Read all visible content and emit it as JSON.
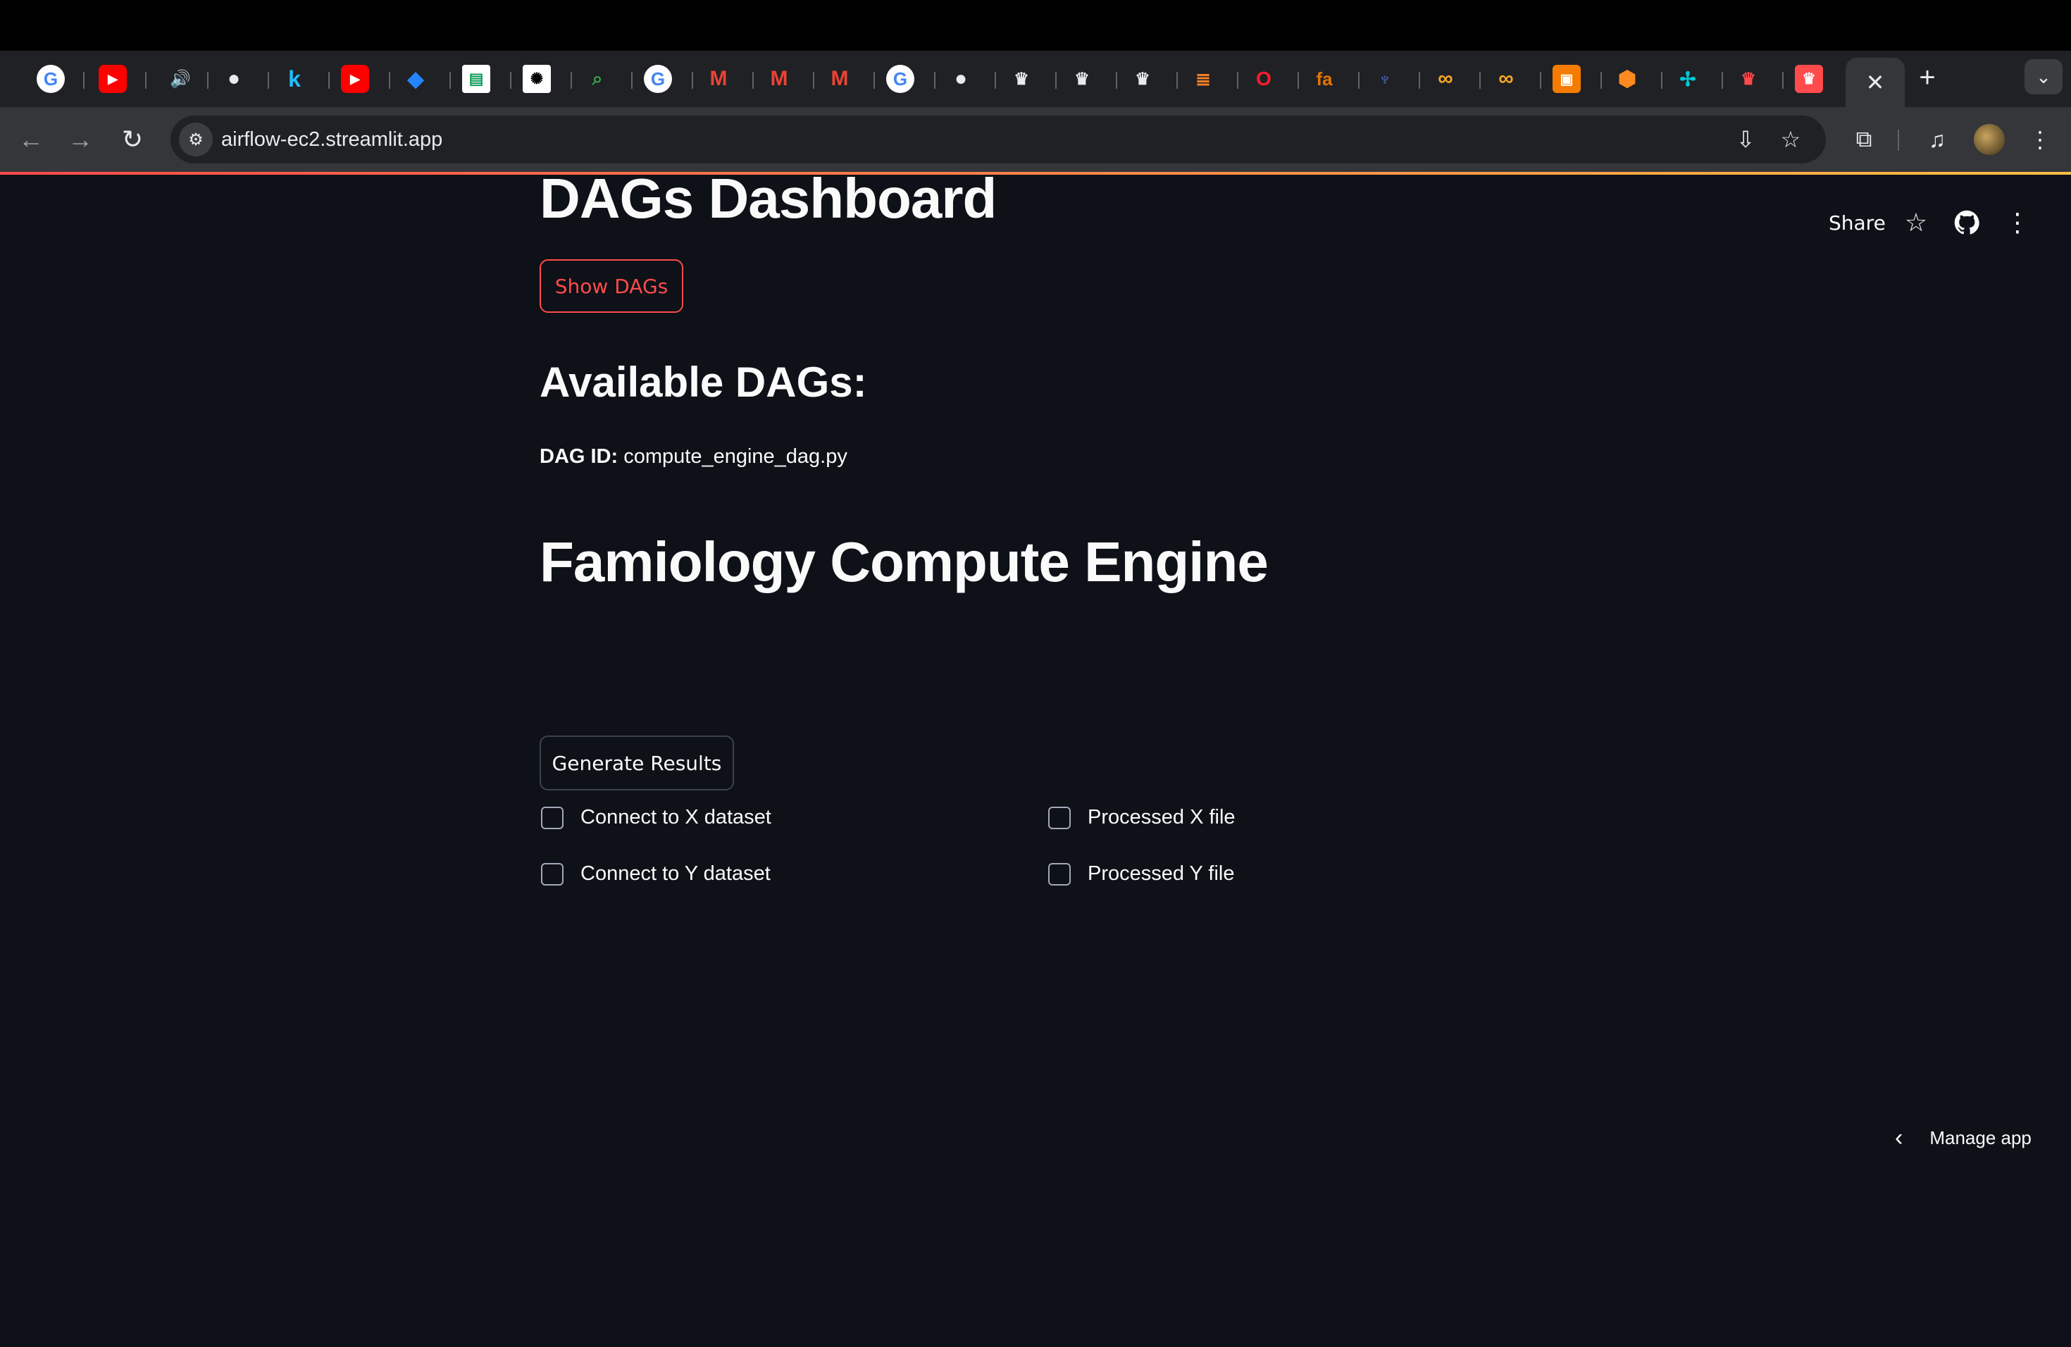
{
  "browser": {
    "tabs_favicons": [
      "google-icon",
      "youtube-icon",
      "audio-icon",
      "github-icon",
      "k-icon",
      "youtube-icon",
      "jira-icon",
      "sheet-icon",
      "chatgpt-icon",
      "search-lens-icon",
      "google-icon",
      "gmail-icon",
      "gmail-icon",
      "gmail-icon",
      "google-icon",
      "github-icon",
      "crown-icon",
      "crown-icon",
      "crown-icon",
      "stack-icon",
      "opera-icon",
      "fa-icon",
      "cactus-icon",
      "infinity-icon",
      "infinity-icon",
      "square-icon",
      "box-icon",
      "airflow-icon",
      "streamlit-icon",
      "streamlit-active-icon"
    ],
    "active_tab_close": "✕",
    "new_tab": "+",
    "tab_search": "⌄",
    "back": "←",
    "forward": "→",
    "reload": "↻",
    "url": "airflow-ec2.streamlit.app",
    "colors": {
      "tabstrip": "#202124",
      "toolbar": "#35363a",
      "omnibox": "#202124"
    }
  },
  "app_header": {
    "share_label": "Share"
  },
  "main": {
    "title": "DAGs Dashboard",
    "show_dags_label": "Show DAGs",
    "available_heading": "Available DAGs:",
    "dag_id_label": "DAG ID:",
    "dag_id_value": " compute_engine_dag.py",
    "section_title": "Famiology Compute Engine",
    "checkboxes": [
      {
        "label": "Connect to X dataset",
        "checked": false
      },
      {
        "label": "Processed X file",
        "checked": false
      },
      {
        "label": "Connect to Y dataset",
        "checked": false
      },
      {
        "label": "Processed Y file",
        "checked": false
      }
    ],
    "generate_label": "Generate Results"
  },
  "footer": {
    "manage_label": "Manage app"
  },
  "colors": {
    "background": "#0e1117",
    "accent": "#ff4b4b",
    "text": "#fafafa"
  }
}
